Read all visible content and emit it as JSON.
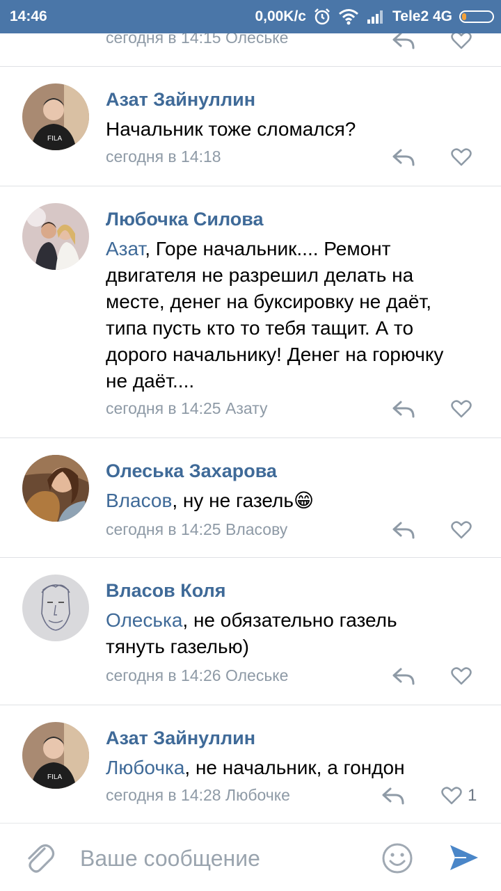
{
  "status_bar": {
    "time": "14:46",
    "speed": "0,00K/c",
    "carrier": "Tele2 4G",
    "icons": [
      "alarm-icon",
      "wifi-icon",
      "signal-icon",
      "battery-icon"
    ]
  },
  "comments": [
    {
      "author": "",
      "text": "",
      "meta": "сегодня в 14:15 Олеське",
      "likes": ""
    },
    {
      "author": "Азат Зайнуллин",
      "mention": "",
      "text": "Начальник тоже сломался?",
      "meta": "сегодня в 14:18",
      "likes": ""
    },
    {
      "author": "Любочка Силова",
      "mention": "Азат",
      "text": ", Горе начальник.... Ремонт двигателя  не разрешил делать на месте, денег на буксировку не даёт, типа пусть кто то тебя тащит. А то дорого начальнику! Денег на горючку не даёт....",
      "meta": "сегодня в 14:25 Азату",
      "likes": ""
    },
    {
      "author": "Олеська Захарова",
      "mention": "Власов",
      "text": ", ну не газель",
      "emoji": "😁",
      "meta": "сегодня в 14:25 Власову",
      "likes": ""
    },
    {
      "author": "Власов Коля",
      "mention": "Олеська",
      "text": ", не обязательно газель тянуть газелью)",
      "meta": "сегодня в 14:26 Олеське",
      "likes": ""
    },
    {
      "author": "Азат Зайнуллин",
      "mention": "Любочка",
      "text": ", не начальник, а гондон",
      "meta": "сегодня в 14:28 Любочке",
      "likes": "1"
    }
  ],
  "composer": {
    "placeholder": "Ваше сообщение",
    "icons": [
      "attach-icon",
      "emoji-icon",
      "send-icon"
    ]
  },
  "colors": {
    "accent": "#4a76a8",
    "link": "#3f6a98",
    "meta": "#8e9aa6"
  }
}
